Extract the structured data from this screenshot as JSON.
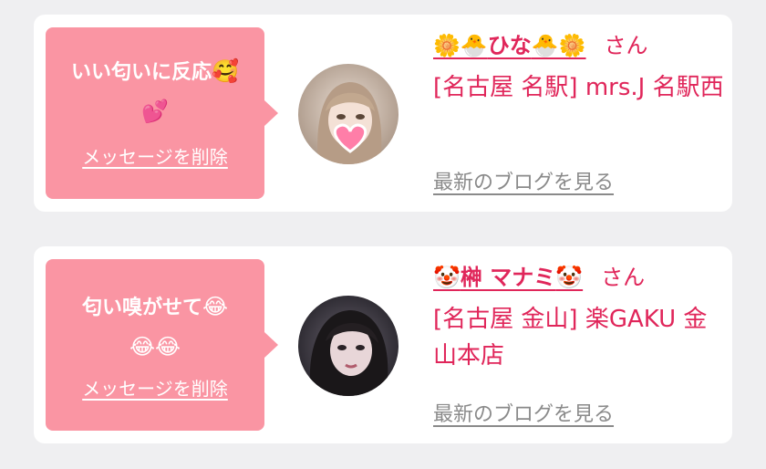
{
  "colors": {
    "accent": "#e0265a",
    "bubble": "#fa95a3",
    "muted": "#8a8a8a",
    "background": "#efeff1"
  },
  "entries": [
    {
      "message_text": "いい匂いに反応",
      "message_emoji": "🥰",
      "message_emoji_line": "💕",
      "delete_label": "メッセージを削除",
      "name_prefix_emoji": "🌼🐣",
      "name": "ひな",
      "name_suffix_emoji": "🐣🌼",
      "honorific": "さん",
      "shop": "[名古屋 名駅] mrs.J 名駅西",
      "blog_link": "最新のブログを見る",
      "avatar_icon": "heart-sticker-icon"
    },
    {
      "message_text": "匂い嗅がせて",
      "message_emoji": "😂",
      "message_emoji_line": "😂😂",
      "delete_label": "メッセージを削除",
      "name_prefix_emoji": "🤡",
      "name": "榊 マナミ",
      "name_suffix_emoji": "🤡",
      "honorific": "さん",
      "shop": "[名古屋 金山] 楽GAKU 金山本店",
      "blog_link": "最新のブログを見る"
    }
  ]
}
